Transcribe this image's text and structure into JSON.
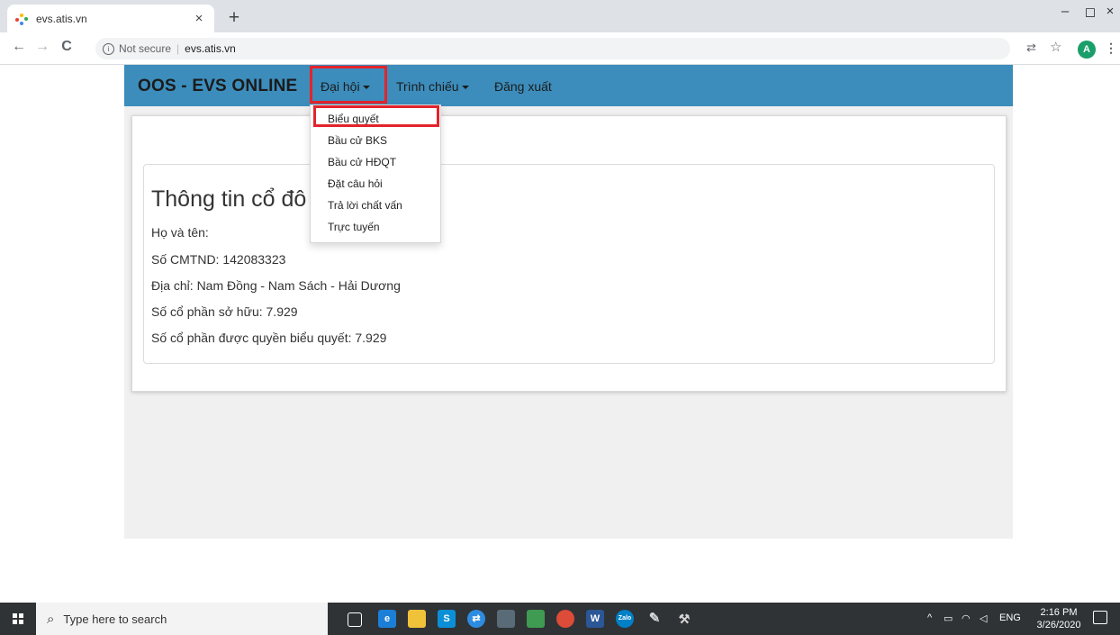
{
  "browser": {
    "tab_title": "evs.atis.vn",
    "tab_close": "×",
    "new_tab": "+",
    "back": "←",
    "forward": "→",
    "reload": "C",
    "security_label": "Not secure",
    "url": "evs.atis.vn",
    "profile_initial": "A",
    "window_minimize": "–",
    "window_restore": "◻",
    "window_close": "×"
  },
  "navbar": {
    "brand": "OOS - EVS ONLINE",
    "menus": [
      {
        "label": "Đại hội"
      },
      {
        "label": "Trình chiếu"
      },
      {
        "label": "Đăng xuất"
      }
    ],
    "dropdown_items": [
      {
        "label": "Biểu quyết"
      },
      {
        "label": "Bầu cử BKS"
      },
      {
        "label": "Bầu cử HĐQT"
      },
      {
        "label": "Đặt câu hỏi"
      },
      {
        "label": "Trả lời chất vấn"
      },
      {
        "label": "Trực tuyến"
      }
    ]
  },
  "shareholder": {
    "heading": "Thông tin cổ đô",
    "name": "Họ và tên:",
    "id_number": "Số CMTND: 142083323",
    "address": "Địa chỉ: Nam Đồng - Nam Sách - Hải Dương",
    "shares_owned": "Số cổ phần sở hữu: 7.929",
    "voting_shares": "Số cổ phần được quyền biểu quyết: 7.929"
  },
  "taskbar": {
    "search_placeholder": "Type here to search",
    "language": "ENG",
    "time": "2:16 PM",
    "date": "3/26/2020"
  },
  "colors": {
    "navbar": "#3c8dbc",
    "highlight": "#e3242b",
    "taskbar": "#2f3336"
  }
}
